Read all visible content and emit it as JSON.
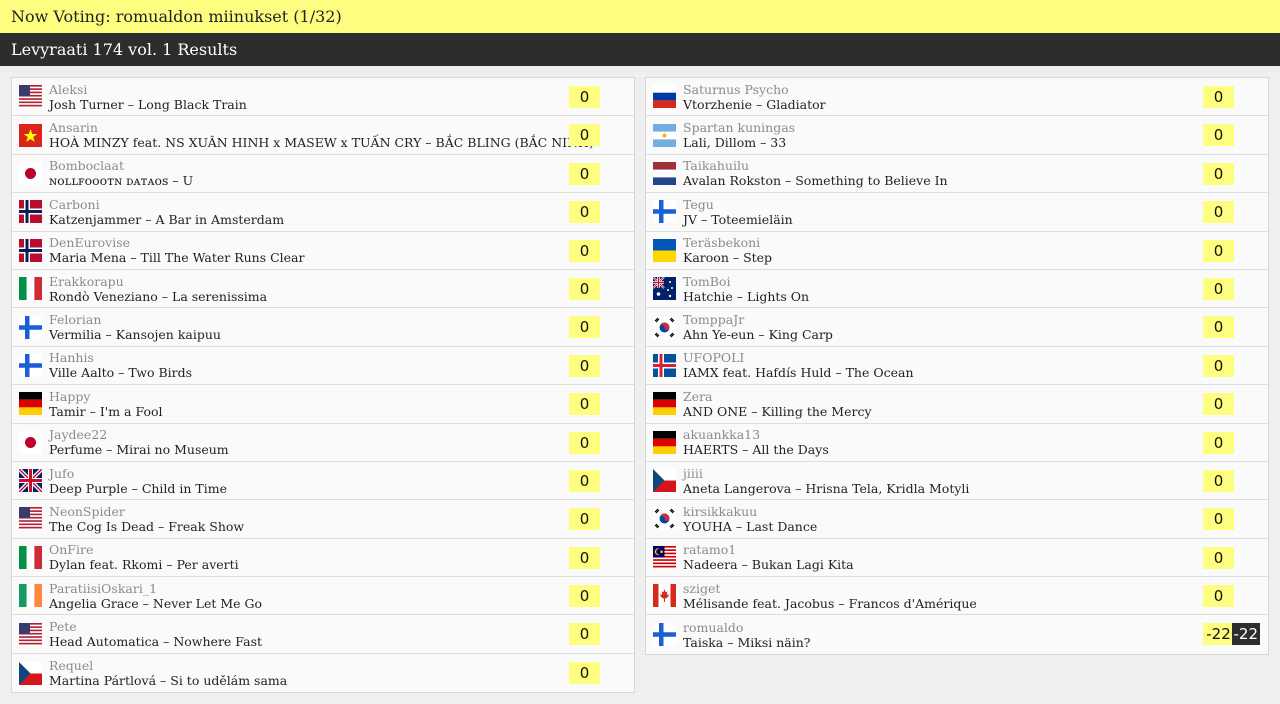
{
  "header": {
    "now_voting": "Now Voting: romualdon miinukset (1/32)",
    "results_title": "Levyraati 174 vol. 1 Results"
  },
  "colors": {
    "accent_yellow": "#fdfd7f",
    "dark_bar": "#2d2d2d"
  },
  "left": [
    {
      "user": "Aleksi",
      "song": "Josh Turner – Long Black Train",
      "score": "0",
      "flag": "us-flag-icon"
    },
    {
      "user": "Ansarin",
      "song": "HOÀ MINZY feat. NS XUÂN HINH x MASEW x TUẤN CRY – BẮC BLING (BẮC NINH)",
      "score": "0",
      "flag": "vn-flag-icon"
    },
    {
      "user": "Bomboclaat",
      "song": "ɴᴏʟʟꜰᴏᴏᴏᴛɴ ᴅᴀᴛᴀᴏꜱ – U",
      "score": "0",
      "flag": "jp-flag-icon"
    },
    {
      "user": "Carboni",
      "song": "Katzenjammer – A Bar in Amsterdam",
      "score": "0",
      "flag": "no-flag-icon"
    },
    {
      "user": "DenEurovise",
      "song": "Maria Mena – Till The Water Runs Clear",
      "score": "0",
      "flag": "no-flag-icon"
    },
    {
      "user": "Erakkorapu",
      "song": "Rondò Veneziano – La serenissima",
      "score": "0",
      "flag": "it-flag-icon"
    },
    {
      "user": "Felorian",
      "song": "Vermilia – Kansojen kaipuu",
      "score": "0",
      "flag": "fi-flag-icon"
    },
    {
      "user": "Hanhis",
      "song": "Ville Aalto – Two Birds",
      "score": "0",
      "flag": "fi-flag-icon"
    },
    {
      "user": "Happy",
      "song": "Tamir – I'm a Fool",
      "score": "0",
      "flag": "de-flag-icon"
    },
    {
      "user": "Jaydee22",
      "song": "Perfume – Mirai no Museum",
      "score": "0",
      "flag": "jp-flag-icon"
    },
    {
      "user": "Jufo",
      "song": "Deep Purple – Child in Time",
      "score": "0",
      "flag": "gb-flag-icon"
    },
    {
      "user": "NeonSpider",
      "song": "The Cog Is Dead – Freak Show",
      "score": "0",
      "flag": "us-flag-icon"
    },
    {
      "user": "OnFire",
      "song": "Dylan feat. Rkomi – Per averti",
      "score": "0",
      "flag": "it-flag-icon"
    },
    {
      "user": "ParatiisiOskari_1",
      "song": "Angelia Grace – Never Let Me Go",
      "score": "0",
      "flag": "ie-flag-icon"
    },
    {
      "user": "Pete",
      "song": "Head Automatica – Nowhere Fast",
      "score": "0",
      "flag": "us-flag-icon"
    },
    {
      "user": "Requel",
      "song": "Martina Pártlová – Si to udělám sama",
      "score": "0",
      "flag": "cz-flag-icon"
    }
  ],
  "right": [
    {
      "user": "Saturnus Psycho",
      "song": "Vtorzhenie – Gladiator",
      "score": "0",
      "flag": "ru-flag-icon"
    },
    {
      "user": "Spartan kuningas",
      "song": "Lali, Dillom – 33",
      "score": "0",
      "flag": "ar-flag-icon"
    },
    {
      "user": "Taikahuilu",
      "song": "Avalan Rokston – Something to Believe In",
      "score": "0",
      "flag": "lv-nl-flag-icon"
    },
    {
      "user": "Tegu",
      "song": "JV – Toteemieläin",
      "score": "0",
      "flag": "fi-flag-icon"
    },
    {
      "user": "Teräsbekoni",
      "song": "Karoon – Step",
      "score": "0",
      "flag": "ua-flag-icon"
    },
    {
      "user": "TomBoi",
      "song": "Hatchie – Lights On",
      "score": "0",
      "flag": "au-flag-icon"
    },
    {
      "user": "TomppaJr",
      "song": "Ahn Ye-eun – King Carp",
      "score": "0",
      "flag": "kr-flag-icon"
    },
    {
      "user": "UFOPOLI",
      "song": "IAMX feat. Hafdís Huld – The Ocean",
      "score": "0",
      "flag": "is-flag-icon"
    },
    {
      "user": "Zera",
      "song": "AND ONE – Killing the Mercy",
      "score": "0",
      "flag": "de-flag-icon"
    },
    {
      "user": "akuankka13",
      "song": "HAERTS – All the Days",
      "score": "0",
      "flag": "de-flag-icon"
    },
    {
      "user": "jiiii",
      "song": "Aneta Langerova – Hrisna Tela, Kridla Motyli",
      "score": "0",
      "flag": "cz-flag-icon"
    },
    {
      "user": "kirsikkakuu",
      "song": "YOUHA – Last Dance",
      "score": "0",
      "flag": "kr-flag-icon"
    },
    {
      "user": "ratamo1",
      "song": "Nadeera – Bukan Lagi Kita",
      "score": "0",
      "flag": "my-flag-icon"
    },
    {
      "user": "sziget",
      "song": "Mélisande feat. Jacobus – Francos d'Amérique",
      "score": "0",
      "flag": "ca-flag-icon"
    },
    {
      "user": "romualdo",
      "song": "Taiska – Miksi näin?",
      "score": "-22",
      "delta": "-22",
      "flag": "fi-flag-icon"
    }
  ]
}
